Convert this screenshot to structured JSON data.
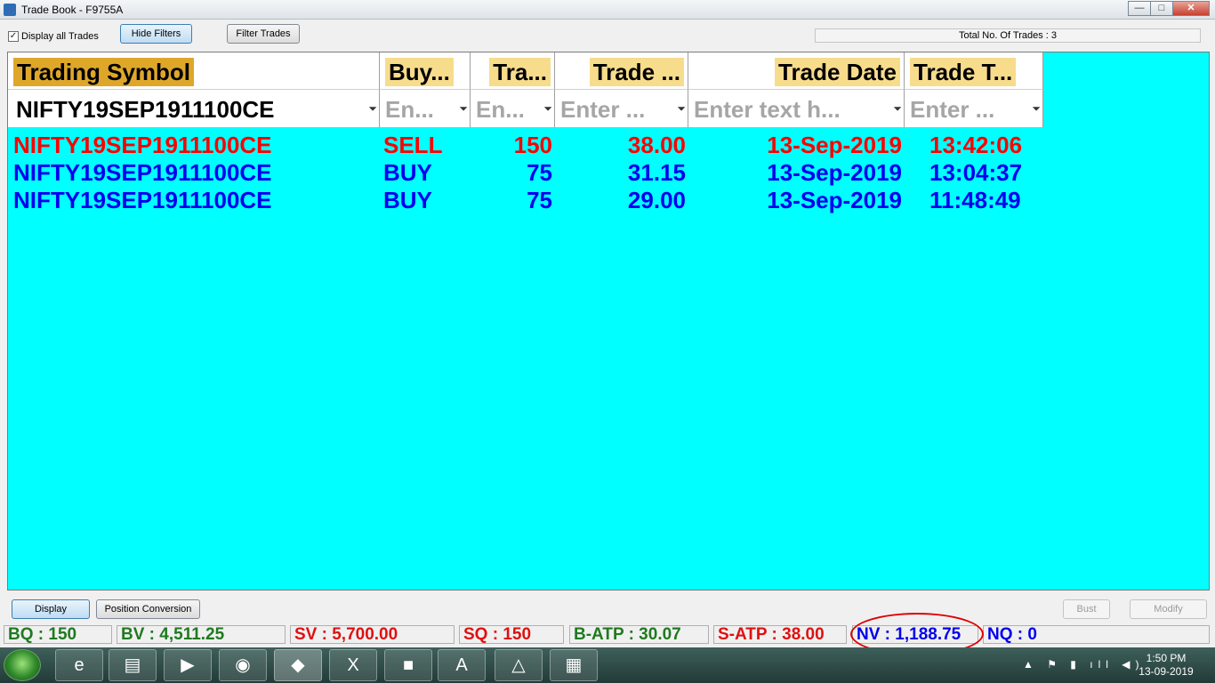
{
  "window": {
    "title": "Trade Book - F9755A",
    "controls": [
      "—",
      "□",
      "✕"
    ]
  },
  "toolbar": {
    "display_all_checked": "✓",
    "display_all_label": "Display all Trades",
    "hide_filters_label": "Hide Filters",
    "filter_trades_label": "Filter Trades",
    "total_trades": "Total No. Of Trades : 3"
  },
  "grid": {
    "headers": [
      "Trading Symbol",
      "Buy...",
      "Tra...",
      "Trade ...",
      "Trade Date",
      "Trade T..."
    ],
    "filters": [
      "NIFTY19SEP1911100CE",
      "En...",
      "En...",
      "Enter ...",
      "Enter text h...",
      "Enter ..."
    ],
    "rows": [
      {
        "symbol": "NIFTY19SEP1911100CE",
        "side": "SELL",
        "qty": "150",
        "price": "38.00",
        "date": "13-Sep-2019",
        "time": "13:42:06"
      },
      {
        "symbol": "NIFTY19SEP1911100CE",
        "side": "BUY",
        "qty": "75",
        "price": "31.15",
        "date": "13-Sep-2019",
        "time": "13:04:37"
      },
      {
        "symbol": "NIFTY19SEP1911100CE",
        "side": "BUY",
        "qty": "75",
        "price": "29.00",
        "date": "13-Sep-2019",
        "time": "11:48:49"
      }
    ],
    "colors": {
      "background": "#00ffff",
      "sell": "#ff0000",
      "buy": "#0000ee"
    }
  },
  "actions": {
    "display_label": "Display",
    "position_conversion_label": "Position Conversion",
    "bust_label": "Bust",
    "modify_label": "Modify"
  },
  "status": {
    "bq": "BQ : 150",
    "bv": "BV : 4,511.25",
    "sv": "SV : 5,700.00",
    "sq": "SQ : 150",
    "b_atp": "B-ATP : 30.07",
    "s_atp": "S-ATP : 38.00",
    "nv": "NV : 1,188.75",
    "nq": "NQ : 0"
  },
  "taskbar": {
    "icons": [
      "internet-explorer-icon",
      "file-explorer-icon",
      "media-player-icon",
      "chrome-icon",
      "trading-app-icon",
      "excel-icon",
      "office-icon",
      "pdf-reader-icon",
      "drive-icon",
      "calculator-icon"
    ],
    "time": "1:50 PM",
    "date": "13-09-2019"
  }
}
